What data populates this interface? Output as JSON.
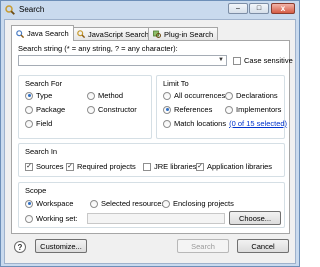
{
  "window": {
    "title": "Search",
    "minimize_glyph": "–",
    "maximize_glyph": "□",
    "close_glyph": "x"
  },
  "tabs": [
    {
      "label": "Java Search",
      "icon": "java-search-icon",
      "active": true
    },
    {
      "label": "JavaScript Search",
      "icon": "javascript-search-icon",
      "active": false
    },
    {
      "label": "Plug-in Search",
      "icon": "plugin-search-icon",
      "active": false
    }
  ],
  "search_string": {
    "label": "Search string (* = any string, ? = any character):",
    "value": "",
    "case_sensitive_label": "Case sensitive",
    "case_sensitive_checked": false
  },
  "search_for": {
    "title": "Search For",
    "options": [
      {
        "label": "Type",
        "selected": true
      },
      {
        "label": "Method",
        "selected": false
      },
      {
        "label": "Package",
        "selected": false
      },
      {
        "label": "Constructor",
        "selected": false
      },
      {
        "label": "Field",
        "selected": false
      }
    ]
  },
  "limit_to": {
    "title": "Limit To",
    "options": [
      {
        "label": "All occurrences",
        "selected": false
      },
      {
        "label": "Declarations",
        "selected": false
      },
      {
        "label": "References",
        "selected": true
      },
      {
        "label": "Implementors",
        "selected": false
      },
      {
        "label": "Match locations",
        "selected": false
      }
    ],
    "selected_link": "(0 of 15 selected)"
  },
  "search_in": {
    "title": "Search In",
    "options": [
      {
        "label": "Sources",
        "checked": true
      },
      {
        "label": "Required projects",
        "checked": true
      },
      {
        "label": "JRE libraries",
        "checked": false
      },
      {
        "label": "Application libraries",
        "checked": true
      }
    ]
  },
  "scope": {
    "title": "Scope",
    "options": [
      {
        "label": "Workspace",
        "selected": true
      },
      {
        "label": "Selected resources",
        "selected": false
      },
      {
        "label": "Enclosing projects",
        "selected": false
      },
      {
        "label": "Working set:",
        "selected": false
      }
    ],
    "working_set_value": "",
    "choose_label": "Choose..."
  },
  "footer": {
    "help_glyph": "?",
    "customize_label": "Customize...",
    "search_label": "Search",
    "cancel_label": "Cancel"
  },
  "colors": {
    "frame": "#c9daee",
    "accent_radio": "#2f6fc4",
    "link": "#0033cc"
  }
}
